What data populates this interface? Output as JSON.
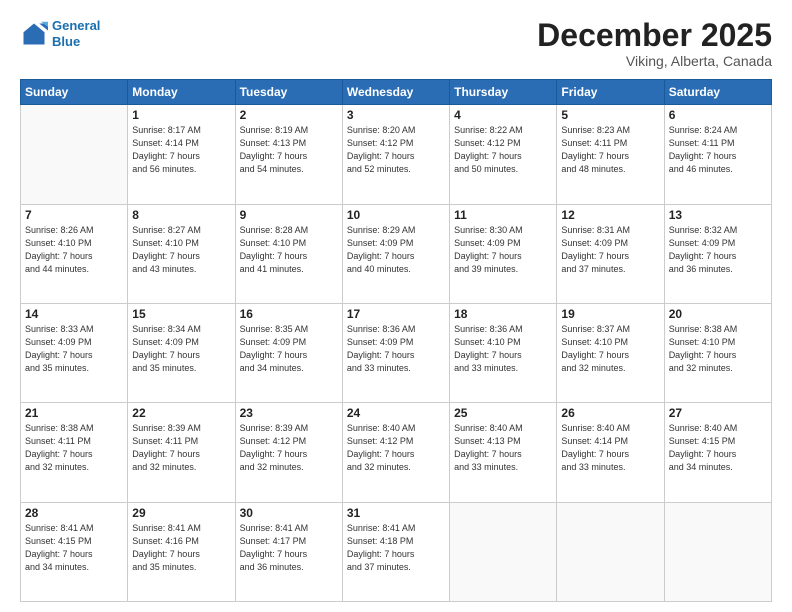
{
  "header": {
    "logo": {
      "line1": "General",
      "line2": "Blue"
    },
    "title": "December 2025",
    "location": "Viking, Alberta, Canada"
  },
  "weekdays": [
    "Sunday",
    "Monday",
    "Tuesday",
    "Wednesday",
    "Thursday",
    "Friday",
    "Saturday"
  ],
  "weeks": [
    [
      {
        "day": "",
        "sunrise": "",
        "sunset": "",
        "daylight": ""
      },
      {
        "day": "1",
        "sunrise": "Sunrise: 8:17 AM",
        "sunset": "Sunset: 4:14 PM",
        "daylight": "Daylight: 7 hours and 56 minutes."
      },
      {
        "day": "2",
        "sunrise": "Sunrise: 8:19 AM",
        "sunset": "Sunset: 4:13 PM",
        "daylight": "Daylight: 7 hours and 54 minutes."
      },
      {
        "day": "3",
        "sunrise": "Sunrise: 8:20 AM",
        "sunset": "Sunset: 4:12 PM",
        "daylight": "Daylight: 7 hours and 52 minutes."
      },
      {
        "day": "4",
        "sunrise": "Sunrise: 8:22 AM",
        "sunset": "Sunset: 4:12 PM",
        "daylight": "Daylight: 7 hours and 50 minutes."
      },
      {
        "day": "5",
        "sunrise": "Sunrise: 8:23 AM",
        "sunset": "Sunset: 4:11 PM",
        "daylight": "Daylight: 7 hours and 48 minutes."
      },
      {
        "day": "6",
        "sunrise": "Sunrise: 8:24 AM",
        "sunset": "Sunset: 4:11 PM",
        "daylight": "Daylight: 7 hours and 46 minutes."
      }
    ],
    [
      {
        "day": "7",
        "sunrise": "Sunrise: 8:26 AM",
        "sunset": "Sunset: 4:10 PM",
        "daylight": "Daylight: 7 hours and 44 minutes."
      },
      {
        "day": "8",
        "sunrise": "Sunrise: 8:27 AM",
        "sunset": "Sunset: 4:10 PM",
        "daylight": "Daylight: 7 hours and 43 minutes."
      },
      {
        "day": "9",
        "sunrise": "Sunrise: 8:28 AM",
        "sunset": "Sunset: 4:10 PM",
        "daylight": "Daylight: 7 hours and 41 minutes."
      },
      {
        "day": "10",
        "sunrise": "Sunrise: 8:29 AM",
        "sunset": "Sunset: 4:09 PM",
        "daylight": "Daylight: 7 hours and 40 minutes."
      },
      {
        "day": "11",
        "sunrise": "Sunrise: 8:30 AM",
        "sunset": "Sunset: 4:09 PM",
        "daylight": "Daylight: 7 hours and 39 minutes."
      },
      {
        "day": "12",
        "sunrise": "Sunrise: 8:31 AM",
        "sunset": "Sunset: 4:09 PM",
        "daylight": "Daylight: 7 hours and 37 minutes."
      },
      {
        "day": "13",
        "sunrise": "Sunrise: 8:32 AM",
        "sunset": "Sunset: 4:09 PM",
        "daylight": "Daylight: 7 hours and 36 minutes."
      }
    ],
    [
      {
        "day": "14",
        "sunrise": "Sunrise: 8:33 AM",
        "sunset": "Sunset: 4:09 PM",
        "daylight": "Daylight: 7 hours and 35 minutes."
      },
      {
        "day": "15",
        "sunrise": "Sunrise: 8:34 AM",
        "sunset": "Sunset: 4:09 PM",
        "daylight": "Daylight: 7 hours and 35 minutes."
      },
      {
        "day": "16",
        "sunrise": "Sunrise: 8:35 AM",
        "sunset": "Sunset: 4:09 PM",
        "daylight": "Daylight: 7 hours and 34 minutes."
      },
      {
        "day": "17",
        "sunrise": "Sunrise: 8:36 AM",
        "sunset": "Sunset: 4:09 PM",
        "daylight": "Daylight: 7 hours and 33 minutes."
      },
      {
        "day": "18",
        "sunrise": "Sunrise: 8:36 AM",
        "sunset": "Sunset: 4:10 PM",
        "daylight": "Daylight: 7 hours and 33 minutes."
      },
      {
        "day": "19",
        "sunrise": "Sunrise: 8:37 AM",
        "sunset": "Sunset: 4:10 PM",
        "daylight": "Daylight: 7 hours and 32 minutes."
      },
      {
        "day": "20",
        "sunrise": "Sunrise: 8:38 AM",
        "sunset": "Sunset: 4:10 PM",
        "daylight": "Daylight: 7 hours and 32 minutes."
      }
    ],
    [
      {
        "day": "21",
        "sunrise": "Sunrise: 8:38 AM",
        "sunset": "Sunset: 4:11 PM",
        "daylight": "Daylight: 7 hours and 32 minutes."
      },
      {
        "day": "22",
        "sunrise": "Sunrise: 8:39 AM",
        "sunset": "Sunset: 4:11 PM",
        "daylight": "Daylight: 7 hours and 32 minutes."
      },
      {
        "day": "23",
        "sunrise": "Sunrise: 8:39 AM",
        "sunset": "Sunset: 4:12 PM",
        "daylight": "Daylight: 7 hours and 32 minutes."
      },
      {
        "day": "24",
        "sunrise": "Sunrise: 8:40 AM",
        "sunset": "Sunset: 4:12 PM",
        "daylight": "Daylight: 7 hours and 32 minutes."
      },
      {
        "day": "25",
        "sunrise": "Sunrise: 8:40 AM",
        "sunset": "Sunset: 4:13 PM",
        "daylight": "Daylight: 7 hours and 33 minutes."
      },
      {
        "day": "26",
        "sunrise": "Sunrise: 8:40 AM",
        "sunset": "Sunset: 4:14 PM",
        "daylight": "Daylight: 7 hours and 33 minutes."
      },
      {
        "day": "27",
        "sunrise": "Sunrise: 8:40 AM",
        "sunset": "Sunset: 4:15 PM",
        "daylight": "Daylight: 7 hours and 34 minutes."
      }
    ],
    [
      {
        "day": "28",
        "sunrise": "Sunrise: 8:41 AM",
        "sunset": "Sunset: 4:15 PM",
        "daylight": "Daylight: 7 hours and 34 minutes."
      },
      {
        "day": "29",
        "sunrise": "Sunrise: 8:41 AM",
        "sunset": "Sunset: 4:16 PM",
        "daylight": "Daylight: 7 hours and 35 minutes."
      },
      {
        "day": "30",
        "sunrise": "Sunrise: 8:41 AM",
        "sunset": "Sunset: 4:17 PM",
        "daylight": "Daylight: 7 hours and 36 minutes."
      },
      {
        "day": "31",
        "sunrise": "Sunrise: 8:41 AM",
        "sunset": "Sunset: 4:18 PM",
        "daylight": "Daylight: 7 hours and 37 minutes."
      },
      {
        "day": "",
        "sunrise": "",
        "sunset": "",
        "daylight": ""
      },
      {
        "day": "",
        "sunrise": "",
        "sunset": "",
        "daylight": ""
      },
      {
        "day": "",
        "sunrise": "",
        "sunset": "",
        "daylight": ""
      }
    ]
  ]
}
